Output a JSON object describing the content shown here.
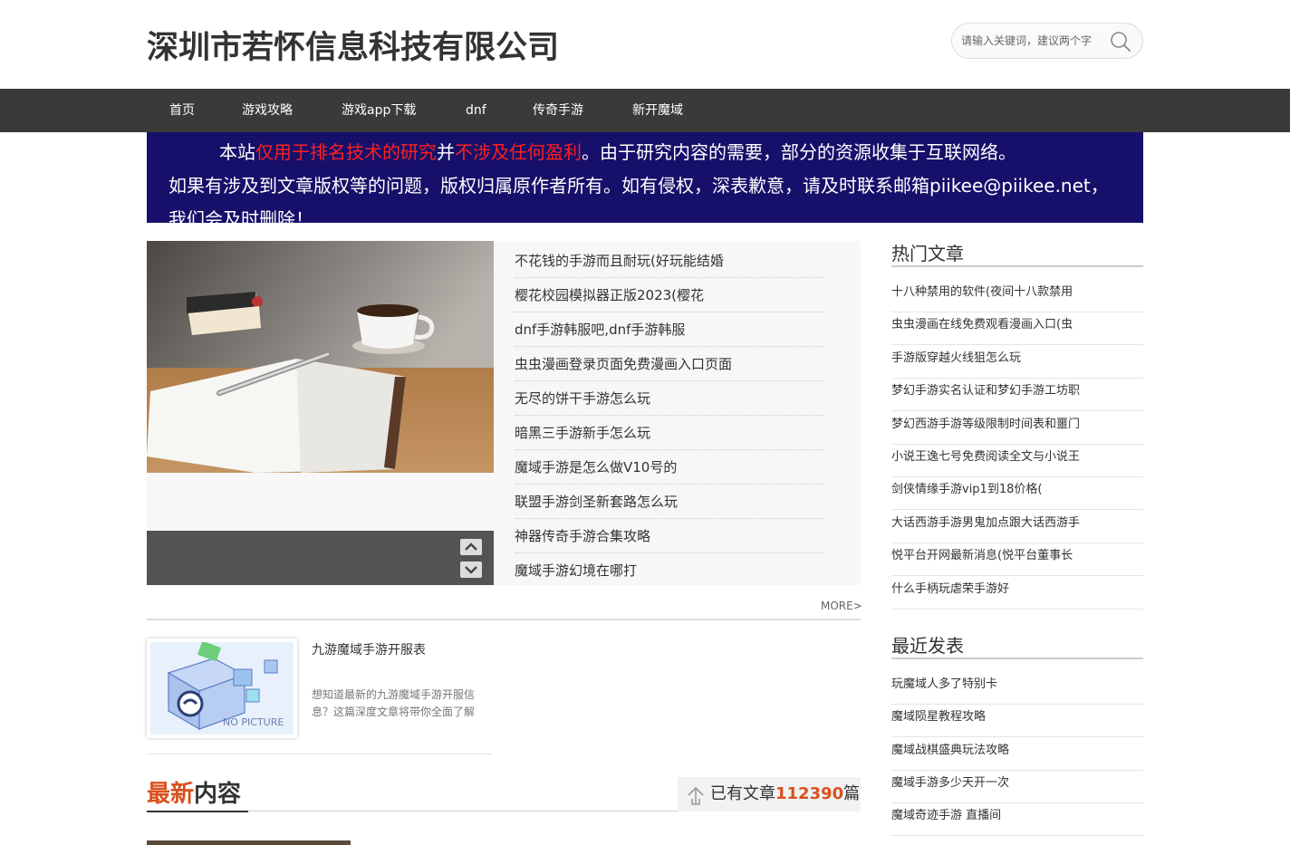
{
  "header": {
    "site_title": "深圳市若怀信息科技有限公司",
    "search_placeholder": "请输入关键词，建议两个字"
  },
  "nav": {
    "items": [
      "首页",
      "游戏攻略",
      "游戏app下载",
      "dnf",
      "传奇手游",
      "新开魔域"
    ]
  },
  "notice": {
    "line1_a": "本站",
    "line1_b": "仅用于排名技术的研究",
    "line1_c": "并",
    "line1_d": "不涉及任何盈利",
    "line1_e": "。由于研究内容的需要，部分的资源收集于互联网络。",
    "line2": "如果有涉及到文章版权等的问题，版权归属原作者所有。如有侵权，深表歉意，请及时联系邮箱piikee@piikee.net，",
    "line3": "我们会及时删除！"
  },
  "top_list": {
    "items": [
      "不花钱的手游而且耐玩(好玩能结婚",
      "樱花校园模拟器正版2023(樱花",
      "dnf手游韩服吧,dnf手游韩服",
      "虫虫漫画登录页面免费漫画入口页面",
      "无尽的饼干手游怎么玩",
      "暗黑三手游新手怎么玩",
      "魔域手游是怎么做V10号的",
      "联盟手游剑圣新套路怎么玩",
      "神器传奇手游合集攻略",
      "魔域手游幻境在哪打"
    ],
    "more_label": "MORE>"
  },
  "featured_post": {
    "title": "九游魔域手游开服表",
    "summary": "想知道最新的九游魔域手游开服信息？这篇深度文章将带你全面了解",
    "thumb_text": "NO PICTURE"
  },
  "latest": {
    "title_accent": "最新",
    "title_rest": "内容",
    "count_prefix": "已有文章",
    "count_value": "112390",
    "count_suffix": "篇"
  },
  "sidebar": {
    "hot_title": "热门文章",
    "hot_items": [
      "十八种禁用的软件(夜间十八款禁用",
      "虫虫漫画在线免费观看漫画入口(虫",
      "手游版穿越火线狙怎么玩",
      "梦幻手游实名认证和梦幻手游工坊职",
      "梦幻西游手游等级限制时间表和噩门",
      "小说王逸七号免费阅读全文与小说王",
      "剑侠情缘手游vip1到18价格(",
      "大话西游手游男鬼加点跟大话西游手",
      "悦平台开网最新消息(悦平台董事长",
      "什么手柄玩虐荣手游好"
    ],
    "recent_title": "最近发表",
    "recent_items": [
      "玩魔域人多了特别卡",
      "魔域陨星教程攻略",
      "魔域战棋盛典玩法攻略",
      "魔域手游多少天开一次",
      "魔域奇迹手游 直播间"
    ]
  },
  "colors": {
    "nav_bg": "#3a3a3a",
    "notice_bg": "#16106a",
    "notice_highlight": "#ff1f1f",
    "accent": "#d9501d"
  }
}
